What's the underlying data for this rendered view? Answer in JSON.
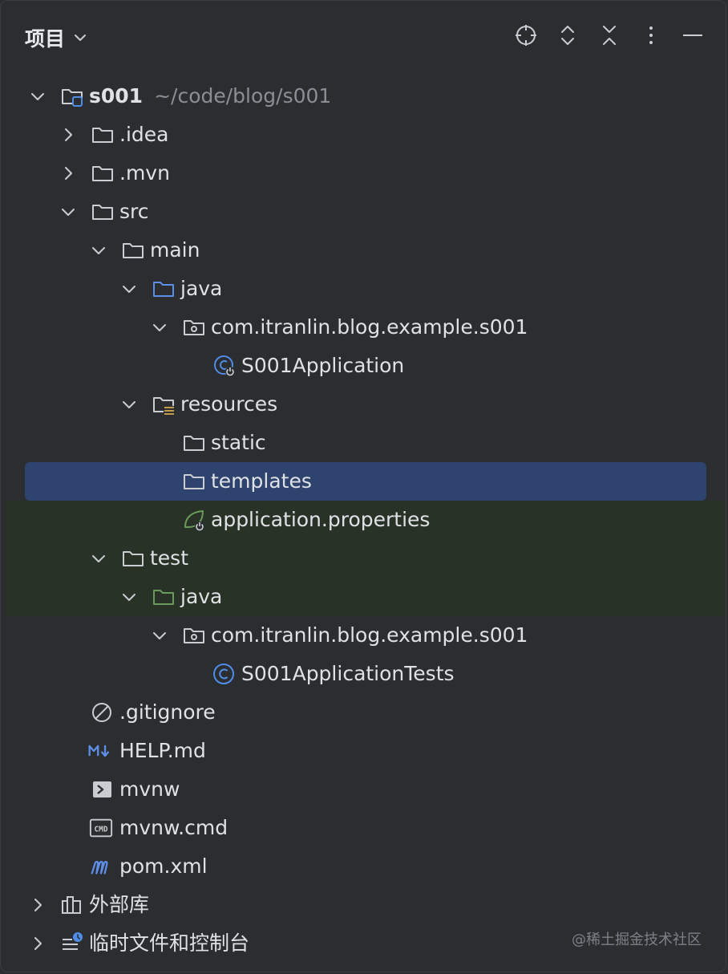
{
  "header": {
    "title": "项目"
  },
  "tree": {
    "root": {
      "name": "s001",
      "path": "~/code/blog/s001"
    },
    "idea": ".idea",
    "mvn": ".mvn",
    "src": "src",
    "main": "main",
    "main_java": "java",
    "main_package": "com.itranlin.blog.example.s001",
    "main_class": "S001Application",
    "resources": "resources",
    "static": "static",
    "templates": "templates",
    "app_props": "application.properties",
    "test": "test",
    "test_java": "java",
    "test_package": "com.itranlin.blog.example.s001",
    "test_class": "S001ApplicationTests",
    "gitignore": ".gitignore",
    "help": "HELP.md",
    "mvnw": "mvnw",
    "mvnw_cmd": "mvnw.cmd",
    "pom": "pom.xml",
    "external": "外部库",
    "scratches": "临时文件和控制台"
  },
  "watermark": "@稀土掘金技术社区",
  "colors": {
    "background": "#2b2d30",
    "selection": "#2e436e",
    "test_scope": "#283227",
    "source_folder": "#5e8fe8",
    "test_folder": "#6a9b5a",
    "class_icon": "#4f8de9"
  }
}
